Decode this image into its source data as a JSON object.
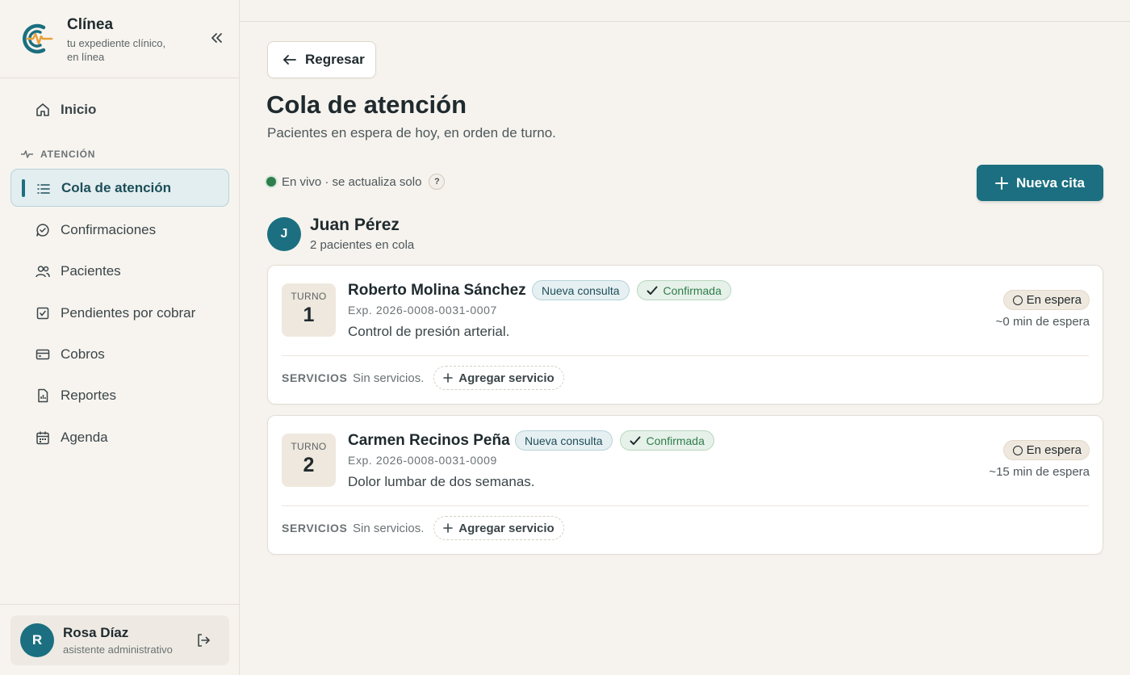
{
  "brand": {
    "name": "Clínea",
    "tagline": "tu expediente clínico, en línea",
    "accent": "#1b6f80",
    "logo_orange": "#e8a13a"
  },
  "sidebar": {
    "items": [
      {
        "label": "Inicio",
        "icon": "home-icon"
      },
      {
        "label": "Cola de atención",
        "icon": "list-icon",
        "active": true
      },
      {
        "label": "Confirmaciones",
        "icon": "chat-check-icon"
      },
      {
        "label": "Pacientes",
        "icon": "users-icon"
      },
      {
        "label": "Pendientes por cobrar",
        "icon": "checkbox-icon"
      },
      {
        "label": "Cobros",
        "icon": "credit-card-icon"
      },
      {
        "label": "Reportes",
        "icon": "report-icon"
      },
      {
        "label": "Agenda",
        "icon": "calendar-icon"
      }
    ],
    "section_label": "ATENCIÓN"
  },
  "user": {
    "initial": "R",
    "name": "Rosa Díaz",
    "role": "asistente administrativo"
  },
  "main": {
    "back_label": "Regresar",
    "title": "Cola de atención",
    "subtitle": "Pacientes en espera de hoy, en orden de turno.",
    "live_text": "En vivo · se actualiza solo",
    "help": "?",
    "new_label": "Nueva cita"
  },
  "doctor": {
    "initial": "J",
    "name": "Juan Pérez",
    "count": "2 pacientes en cola"
  },
  "queue": [
    {
      "turno_label": "TURNO",
      "turno": "1",
      "name": "Roberto Molina Sánchez",
      "type_badge": "Nueva consulta",
      "confirm_badge": "Confirmada",
      "exp": "Exp. 2026-0008-0031-0007",
      "reason": "Control de presión arterial.",
      "status": "En espera",
      "wait": "~0 min de espera",
      "services_label": "SERVICIOS",
      "services_none": "Sin servicios.",
      "add_service": "Agregar servicio"
    },
    {
      "turno_label": "TURNO",
      "turno": "2",
      "name": "Carmen Recinos Peña",
      "type_badge": "Nueva consulta",
      "confirm_badge": "Confirmada",
      "exp": "Exp. 2026-0008-0031-0009",
      "reason": "Dolor lumbar de dos semanas.",
      "status": "En espera",
      "wait": "~15 min de espera",
      "services_label": "SERVICIOS",
      "services_none": "Sin servicios.",
      "add_service": "Agregar servicio"
    }
  ]
}
